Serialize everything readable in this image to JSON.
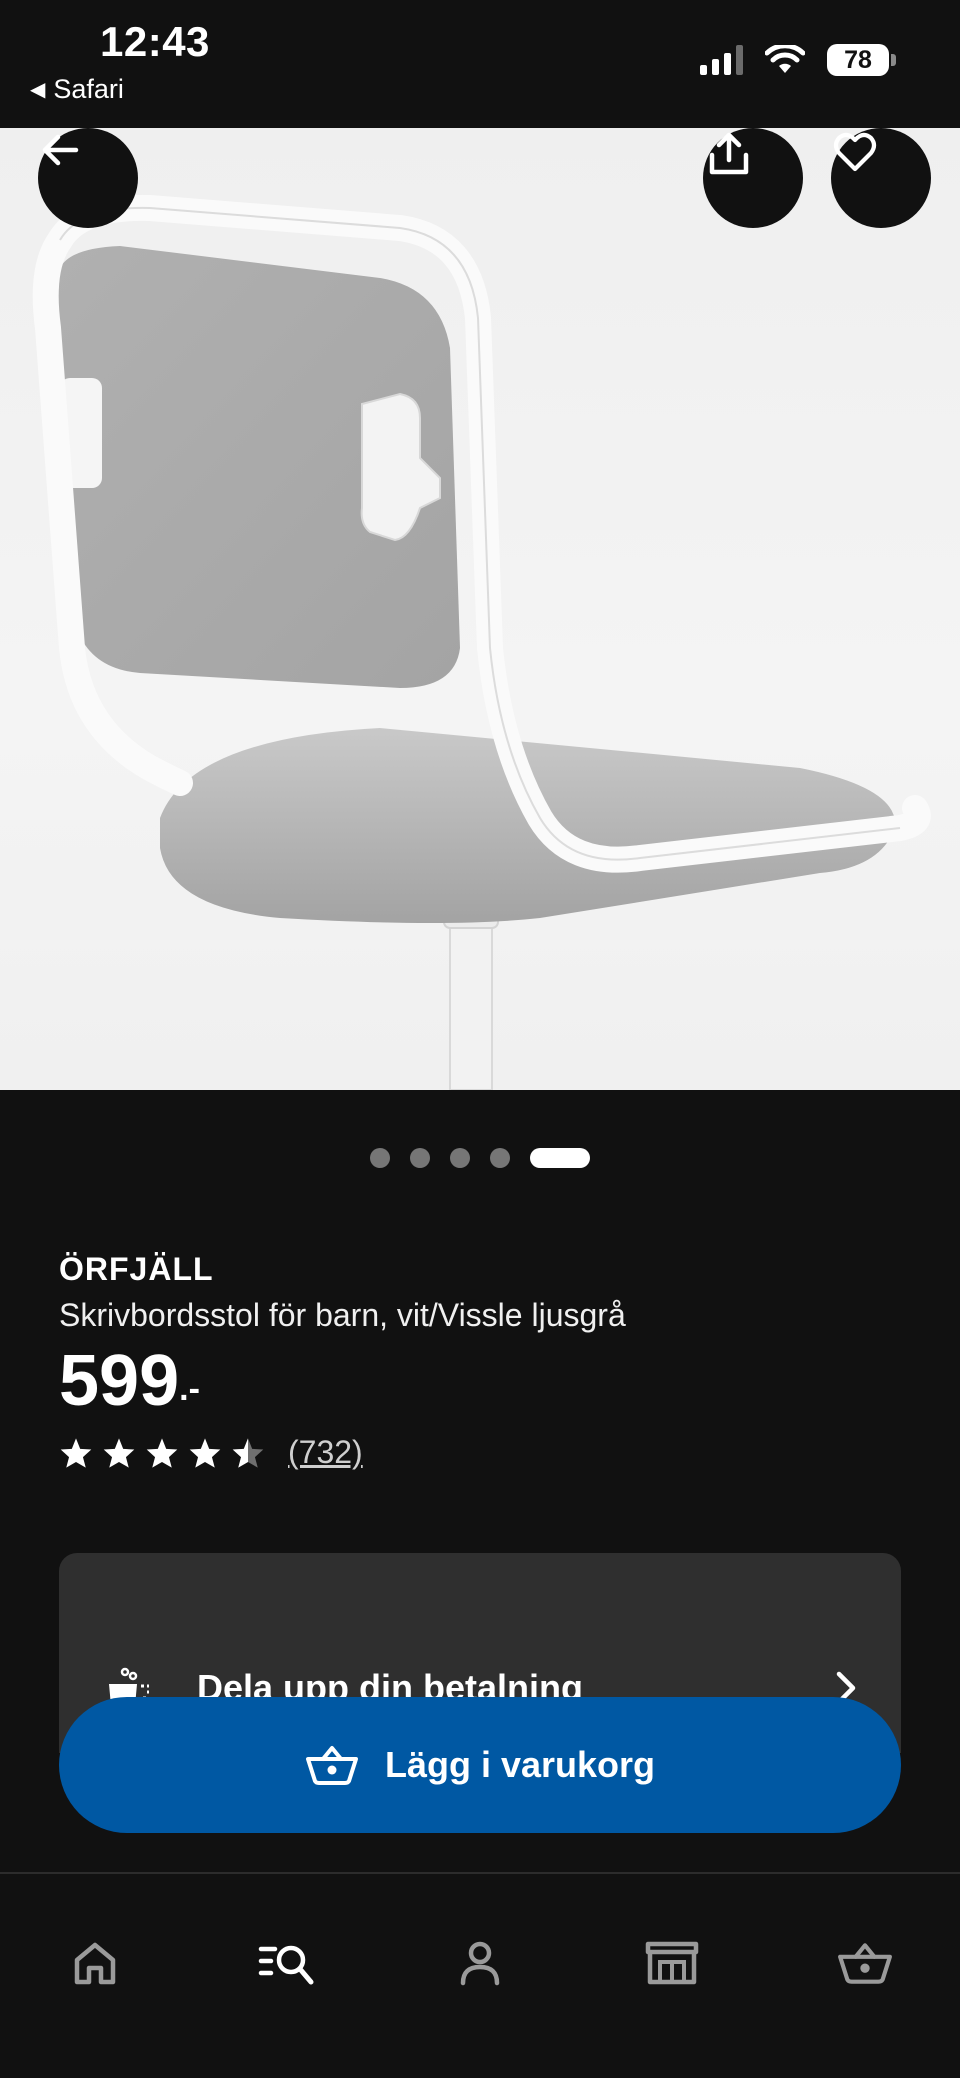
{
  "status_bar": {
    "time": "12:43",
    "back_app": "Safari",
    "battery": "78",
    "icons": [
      "signal-icon",
      "wifi-icon",
      "battery-icon"
    ]
  },
  "hero": {
    "alt_subject": "chair",
    "buttons": [
      "back-arrow-icon",
      "share-icon",
      "heart-icon"
    ]
  },
  "carousel": {
    "total": 5,
    "active_index": 4
  },
  "product": {
    "name": "ÖRFJÄLL",
    "description": "Skrivbordsstol för barn, vit/Vissle ljusgrå",
    "price": "599",
    "price_suffix": ".-",
    "rating": 4.5,
    "review_count": "(732)"
  },
  "payment": {
    "label": "Dela upp din betalning",
    "icon": "split-payment-icon"
  },
  "cart_button": {
    "label": "Lägg i varukorg",
    "icon": "basket-icon"
  },
  "bottom_nav": {
    "items": [
      "home-icon",
      "search-list-icon",
      "profile-icon",
      "store-icon",
      "cart-icon"
    ],
    "active": "search-list-icon"
  },
  "colors": {
    "background": "#111111",
    "card": "#2f2f2f",
    "primary_button": "#0058a3",
    "text": "#ffffff",
    "inactive_nav": "#9a9a9a"
  }
}
